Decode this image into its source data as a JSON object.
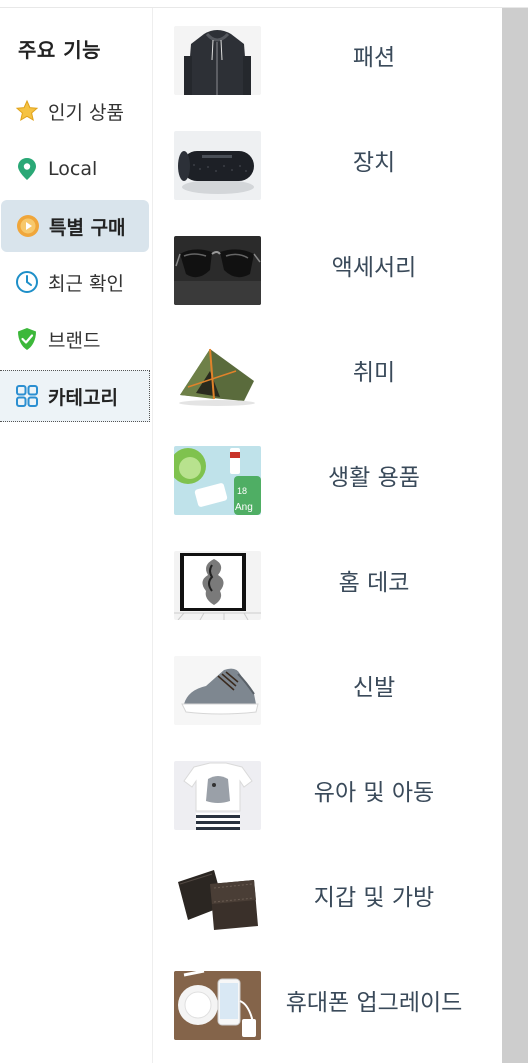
{
  "sidebar": {
    "title": "주요 기능",
    "items": [
      {
        "label": "인기 상품",
        "icon": "star-icon"
      },
      {
        "label": "Local",
        "icon": "location-pin-icon"
      },
      {
        "label": "특별 구매",
        "icon": "special-deal-icon"
      },
      {
        "label": "최근 확인",
        "icon": "clock-icon"
      },
      {
        "label": "브랜드",
        "icon": "shield-check-icon"
      },
      {
        "label": "카테고리",
        "icon": "grid-icon"
      }
    ]
  },
  "categories": [
    {
      "label": "패션",
      "image": "hoodie-image"
    },
    {
      "label": "장치",
      "image": "speaker-image"
    },
    {
      "label": "액세서리",
      "image": "sunglasses-image"
    },
    {
      "label": "취미",
      "image": "tent-image"
    },
    {
      "label": "생활 용품",
      "image": "toiletries-image"
    },
    {
      "label": "홈 데코",
      "image": "wall-art-image"
    },
    {
      "label": "신발",
      "image": "sneaker-image"
    },
    {
      "label": "유아 및 아동",
      "image": "baby-clothes-image"
    },
    {
      "label": "지갑 및 가방",
      "image": "wallet-image"
    },
    {
      "label": "휴대폰 업그레이드",
      "image": "wireless-charger-image"
    }
  ],
  "colors": {
    "accent_active_bg": "#d9e4ec",
    "text_category": "#3a4a5a",
    "star": "#f5c242",
    "pin": "#2aa876",
    "clock": "#1e8fc8",
    "shield": "#3cb83a",
    "grid": "#2c8fd1"
  }
}
